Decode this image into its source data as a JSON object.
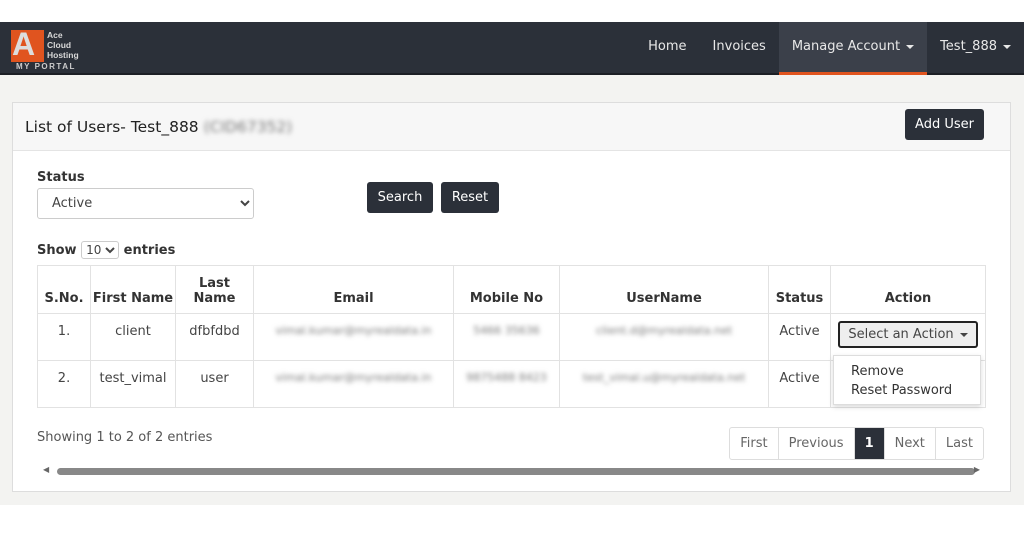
{
  "brand": {
    "logo_text": "Ace Cloud Hosting",
    "portal": "MY PORTAL",
    "accent": "#e0541f"
  },
  "nav": {
    "items": [
      {
        "label": "Home"
      },
      {
        "label": "Invoices"
      },
      {
        "label": "Manage Account",
        "active": true,
        "dropdown": true
      },
      {
        "label": "Test_888",
        "dropdown": true
      }
    ]
  },
  "page": {
    "title": "List of Users- Test_888",
    "account_id": "(CID67352)",
    "add_user": "Add User"
  },
  "filter": {
    "status_label": "Status",
    "status_value": "Active",
    "search": "Search",
    "reset": "Reset"
  },
  "length": {
    "show": "Show",
    "value": "10",
    "entries": "entries"
  },
  "table": {
    "headers": [
      "S.No.",
      "First Name",
      "Last Name",
      "Email",
      "Mobile No",
      "UserName",
      "Status",
      "Action"
    ],
    "rows": [
      {
        "sno": "1.",
        "first": "client",
        "last": "dfbfdbd",
        "email": "vimal.kumar@myrealdata.in",
        "mobile": "5466 35636",
        "username": "client.d@myrealdata.net",
        "status": "Active"
      },
      {
        "sno": "2.",
        "first": "test_vimal",
        "last": "user",
        "email": "vimal.kumar@myrealdata.in",
        "mobile": "9875488 8423",
        "username": "test_vimal.u@myrealdata.net",
        "status": "Active"
      }
    ],
    "action_label": "Select an Action",
    "action_menu": [
      "Remove",
      "Reset Password"
    ]
  },
  "info": "Showing 1 to 2 of 2 entries",
  "pager": {
    "first": "First",
    "previous": "Previous",
    "current": "1",
    "next": "Next",
    "last": "Last"
  }
}
